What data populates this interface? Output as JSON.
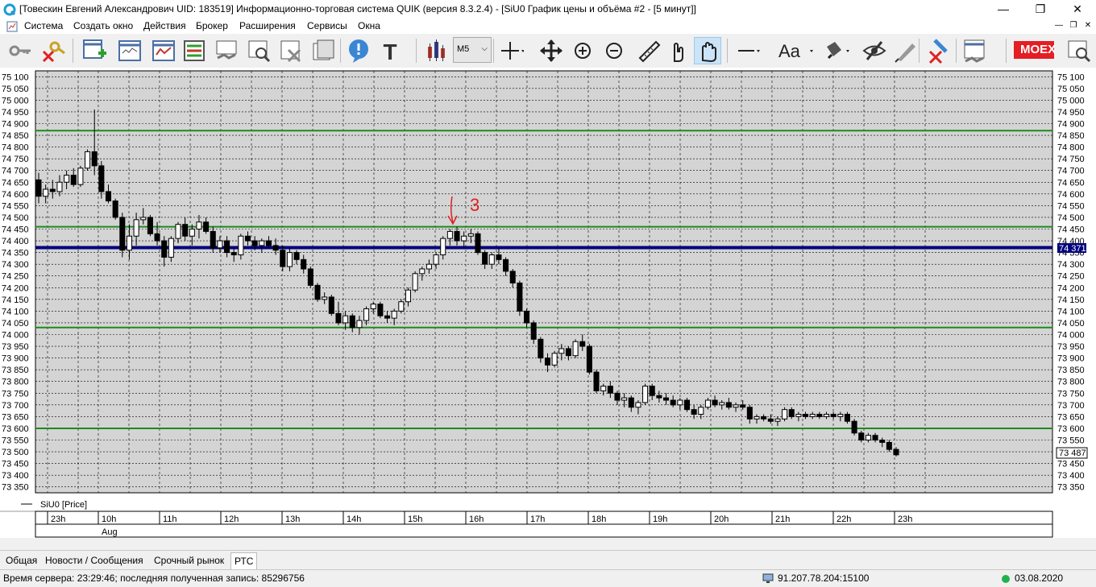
{
  "window": {
    "title": "[Товескин Евгений Александрович UID: 183519] Информационно-торговая система QUIK (версия 8.3.2.4) - [SiU0 График цены и объёма #2 - [5 минут]]",
    "minimize": "—",
    "maximize": "❐",
    "close": "✕"
  },
  "menu": [
    "Система",
    "Создать окно",
    "Действия",
    "Брокер",
    "Расширения",
    "Сервисы",
    "Окна"
  ],
  "toolbar": {
    "interval_value": "M5",
    "text_tool": "T",
    "font_tool": "Aa",
    "exchange_logo": "MOEX"
  },
  "chart": {
    "legend_label": "SiU0 [Price]",
    "current_level_tag": "74 371",
    "last_price_tag": "73 487",
    "annotation_text": "3",
    "date_label": "Aug",
    "colors": {
      "grid": "#000000",
      "level_green": "#1e8a1e",
      "level_blue": "#00007c",
      "annotation": "#e02020",
      "background": "#d4d4d4"
    }
  },
  "chart_data": {
    "type": "candlestick",
    "symbol": "SiU0",
    "timeframe": "5 минут",
    "ylim": [
      73325,
      75125
    ],
    "y_ticks": [
      75100,
      75050,
      75000,
      74950,
      74900,
      74850,
      74800,
      74750,
      74700,
      74650,
      74600,
      74550,
      74500,
      74450,
      74400,
      74350,
      74300,
      74250,
      74200,
      74150,
      74100,
      74050,
      74000,
      73950,
      73900,
      73850,
      73800,
      73750,
      73700,
      73650,
      73600,
      73550,
      73500,
      73450,
      73400,
      73350
    ],
    "y_tick_labels": [
      "75 100",
      "75 050",
      "75 000",
      "74 950",
      "74 900",
      "74 850",
      "74 800",
      "74 750",
      "74 700",
      "74 650",
      "74 600",
      "74 550",
      "74 500",
      "74 450",
      "74 400",
      "74 350",
      "74 300",
      "74 250",
      "74 200",
      "74 150",
      "74 100",
      "74 050",
      "74 000",
      "73 950",
      "73 900",
      "73 850",
      "73 800",
      "73 750",
      "73 700",
      "73 650",
      "73 600",
      "73 550",
      "73 500",
      "73 450",
      "73 400",
      "73 350"
    ],
    "x_labels": [
      "23h",
      "10h",
      "11h",
      "12h",
      "13h",
      "14h",
      "15h",
      "16h",
      "17h",
      "18h",
      "19h",
      "20h",
      "21h",
      "22h",
      "23h"
    ],
    "green_levels": [
      74870,
      74460,
      74030,
      73600
    ],
    "blue_level": 74371,
    "candles": [
      [
        74660,
        74690,
        74560,
        74590
      ],
      [
        74590,
        74640,
        74560,
        74620
      ],
      [
        74620,
        74660,
        74580,
        74610
      ],
      [
        74610,
        74680,
        74590,
        74650
      ],
      [
        74650,
        74700,
        74620,
        74680
      ],
      [
        74680,
        74710,
        74630,
        74640
      ],
      [
        74640,
        74720,
        74630,
        74710
      ],
      [
        74710,
        74790,
        74700,
        74780
      ],
      [
        74780,
        74960,
        74680,
        74720
      ],
      [
        74720,
        74740,
        74580,
        74610
      ],
      [
        74610,
        74640,
        74560,
        74570
      ],
      [
        74570,
        74580,
        74490,
        74500
      ],
      [
        74500,
        74520,
        74330,
        74360
      ],
      [
        74360,
        74470,
        74320,
        74420
      ],
      [
        74420,
        74520,
        74380,
        74490
      ],
      [
        74490,
        74540,
        74470,
        74500
      ],
      [
        74500,
        74510,
        74420,
        74430
      ],
      [
        74430,
        74480,
        74380,
        74400
      ],
      [
        74400,
        74420,
        74290,
        74330
      ],
      [
        74330,
        74420,
        74310,
        74410
      ],
      [
        74410,
        74480,
        74390,
        74470
      ],
      [
        74470,
        74500,
        74400,
        74420
      ],
      [
        74420,
        74470,
        74380,
        74450
      ],
      [
        74450,
        74510,
        74410,
        74480
      ],
      [
        74480,
        74500,
        74430,
        74440
      ],
      [
        74440,
        74460,
        74350,
        74370
      ],
      [
        74370,
        74420,
        74350,
        74400
      ],
      [
        74400,
        74420,
        74330,
        74350
      ],
      [
        74350,
        74370,
        74310,
        74340
      ],
      [
        74340,
        74430,
        74320,
        74420
      ],
      [
        74420,
        74440,
        74380,
        74400
      ],
      [
        74400,
        74420,
        74360,
        74380
      ],
      [
        74380,
        74410,
        74350,
        74400
      ],
      [
        74400,
        74420,
        74370,
        74380
      ],
      [
        74380,
        74410,
        74340,
        74360
      ],
      [
        74360,
        74380,
        74270,
        74290
      ],
      [
        74290,
        74370,
        74270,
        74350
      ],
      [
        74350,
        74360,
        74300,
        74320
      ],
      [
        74320,
        74340,
        74260,
        74280
      ],
      [
        74280,
        74290,
        74200,
        74210
      ],
      [
        74210,
        74220,
        74140,
        74150
      ],
      [
        74150,
        74180,
        74130,
        74160
      ],
      [
        74160,
        74170,
        74080,
        74090
      ],
      [
        74090,
        74140,
        74040,
        74050
      ],
      [
        74050,
        74100,
        74020,
        74080
      ],
      [
        74080,
        74090,
        74010,
        74030
      ],
      [
        74030,
        74080,
        74000,
        74060
      ],
      [
        74060,
        74120,
        74040,
        74110
      ],
      [
        74110,
        74140,
        74090,
        74130
      ],
      [
        74130,
        74140,
        74070,
        74080
      ],
      [
        74080,
        74100,
        74050,
        74070
      ],
      [
        74070,
        74110,
        74040,
        74100
      ],
      [
        74100,
        74150,
        74090,
        74140
      ],
      [
        74140,
        74200,
        74120,
        74190
      ],
      [
        74190,
        74270,
        74180,
        74260
      ],
      [
        74260,
        74290,
        74230,
        74280
      ],
      [
        74280,
        74320,
        74260,
        74300
      ],
      [
        74300,
        74350,
        74280,
        74340
      ],
      [
        74340,
        74420,
        74320,
        74410
      ],
      [
        74410,
        74450,
        74380,
        74440
      ],
      [
        74440,
        74460,
        74380,
        74400
      ],
      [
        74400,
        74440,
        74370,
        74420
      ],
      [
        74420,
        74450,
        74390,
        74430
      ],
      [
        74430,
        74440,
        74340,
        74350
      ],
      [
        74350,
        74360,
        74280,
        74300
      ],
      [
        74300,
        74350,
        74280,
        74340
      ],
      [
        74340,
        74370,
        74300,
        74320
      ],
      [
        74320,
        74330,
        74250,
        74270
      ],
      [
        74270,
        74280,
        74200,
        74220
      ],
      [
        74220,
        74230,
        74080,
        74100
      ],
      [
        74100,
        74110,
        74030,
        74050
      ],
      [
        74050,
        74060,
        73960,
        73980
      ],
      [
        73980,
        73990,
        73880,
        73900
      ],
      [
        73900,
        73920,
        73840,
        73870
      ],
      [
        73870,
        73930,
        73860,
        73920
      ],
      [
        73920,
        73960,
        73890,
        73940
      ],
      [
        73940,
        73950,
        73890,
        73910
      ],
      [
        73910,
        73980,
        73900,
        73970
      ],
      [
        73970,
        74000,
        73930,
        73950
      ],
      [
        73950,
        73960,
        73830,
        73840
      ],
      [
        73840,
        73850,
        73750,
        73760
      ],
      [
        73760,
        73790,
        73740,
        73780
      ],
      [
        73780,
        73800,
        73730,
        73750
      ],
      [
        73750,
        73760,
        73700,
        73720
      ],
      [
        73720,
        73750,
        73690,
        73730
      ],
      [
        73730,
        73740,
        73670,
        73690
      ],
      [
        73690,
        73720,
        73660,
        73710
      ],
      [
        73710,
        73790,
        73700,
        73780
      ],
      [
        73780,
        73790,
        73720,
        73740
      ],
      [
        73740,
        73760,
        73710,
        73730
      ],
      [
        73730,
        73750,
        73700,
        73720
      ],
      [
        73720,
        73740,
        73690,
        73700
      ],
      [
        73700,
        73730,
        73680,
        73720
      ],
      [
        73720,
        73730,
        73670,
        73680
      ],
      [
        73680,
        73700,
        73640,
        73660
      ],
      [
        73660,
        73700,
        73640,
        73690
      ],
      [
        73690,
        73730,
        73680,
        73720
      ],
      [
        73720,
        73740,
        73690,
        73700
      ],
      [
        73700,
        73720,
        73680,
        73710
      ],
      [
        73710,
        73730,
        73680,
        73690
      ],
      [
        73690,
        73710,
        73670,
        73700
      ],
      [
        73700,
        73720,
        73680,
        73690
      ],
      [
        73690,
        73700,
        73620,
        73640
      ],
      [
        73640,
        73660,
        73620,
        73650
      ],
      [
        73650,
        73660,
        73630,
        73640
      ],
      [
        73640,
        73660,
        73620,
        73630
      ],
      [
        73630,
        73650,
        73610,
        73640
      ],
      [
        73640,
        73690,
        73630,
        73680
      ],
      [
        73680,
        73690,
        73640,
        73650
      ],
      [
        73650,
        73670,
        73630,
        73660
      ],
      [
        73660,
        73670,
        73640,
        73650
      ],
      [
        73650,
        73670,
        73640,
        73660
      ],
      [
        73660,
        73670,
        73640,
        73650
      ],
      [
        73650,
        73670,
        73640,
        73660
      ],
      [
        73660,
        73670,
        73640,
        73650
      ],
      [
        73650,
        73670,
        73630,
        73660
      ],
      [
        73660,
        73670,
        73620,
        73630
      ],
      [
        73630,
        73640,
        73570,
        73580
      ],
      [
        73580,
        73590,
        73540,
        73550
      ],
      [
        73550,
        73580,
        73540,
        73570
      ],
      [
        73570,
        73580,
        73540,
        73550
      ],
      [
        73550,
        73560,
        73520,
        73540
      ],
      [
        73540,
        73550,
        73500,
        73510
      ],
      [
        73510,
        73520,
        73480,
        73487
      ]
    ]
  },
  "tabs": [
    "Общая",
    "Новости / Сообщения",
    "Срочный рынок",
    "РТС"
  ],
  "status": {
    "server_time": "Время сервера: 23:29:46; последняя полученная запись: 85296756",
    "connection": "91.207.78.204:15100",
    "date": "03.08.2020"
  }
}
